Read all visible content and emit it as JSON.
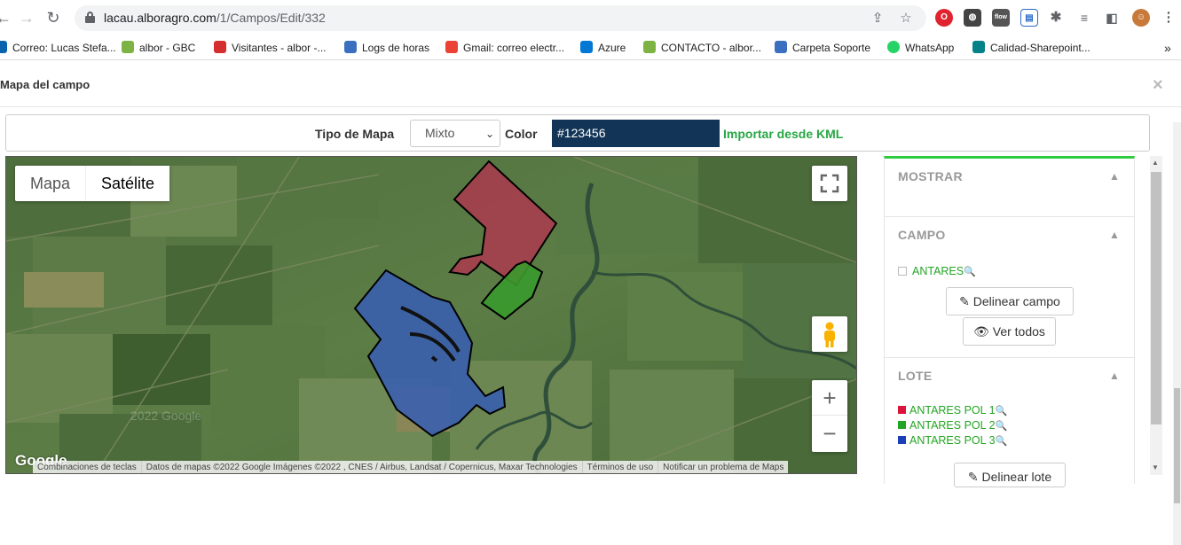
{
  "browser": {
    "url_host": "lacau.alboragro.com",
    "url_path": "/1/Campos/Edit/332",
    "bookmarks": [
      "Correo: Lucas Stefa...",
      "albor - GBC",
      "Visitantes - albor -...",
      "Logs de horas",
      "Gmail: correo electr...",
      "Azure",
      "CONTACTO - albor...",
      "Carpeta Soporte",
      "WhatsApp",
      "Calidad-Sharepoint..."
    ],
    "more": "»"
  },
  "modal": {
    "title": "Mapa del campo",
    "close": "×"
  },
  "toolbar": {
    "map_type_label": "Tipo de Mapa",
    "map_type_value": "Mixto",
    "color_label": "Color",
    "color_value": "#123456",
    "import_link": "Importar desde KML"
  },
  "map": {
    "type_map": "Mapa",
    "type_satellite": "Satélite",
    "zoom_in": "+",
    "zoom_out": "−",
    "google_logo": "Google",
    "attribution": [
      "Combinaciones de teclas",
      "Datos de mapas ©2022 Google Imágenes ©2022 , CNES / Airbus, Landsat / Copernicus, Maxar Technologies",
      "Términos de uso",
      "Notificar un problema de Maps"
    ],
    "field_colors": {
      "campo": "#a63d4e",
      "pol1": "#a63d4e",
      "pol2": "#3a9a2e",
      "pol3": "#3a5fae"
    }
  },
  "panel": {
    "mostrar": {
      "title": "MOSTRAR"
    },
    "campo": {
      "title": "CAMPO",
      "item": "ANTARES",
      "delinear": "Delinear campo",
      "ver_todos": "Ver todos"
    },
    "lote": {
      "title": "LOTE",
      "items": [
        {
          "label": "ANTARES POL 1",
          "color": "#dc143c"
        },
        {
          "label": "ANTARES POL 2",
          "color": "#22a522"
        },
        {
          "label": "ANTARES POL 3",
          "color": "#1a3fb8"
        }
      ],
      "delinear": "Delinear lote"
    }
  }
}
